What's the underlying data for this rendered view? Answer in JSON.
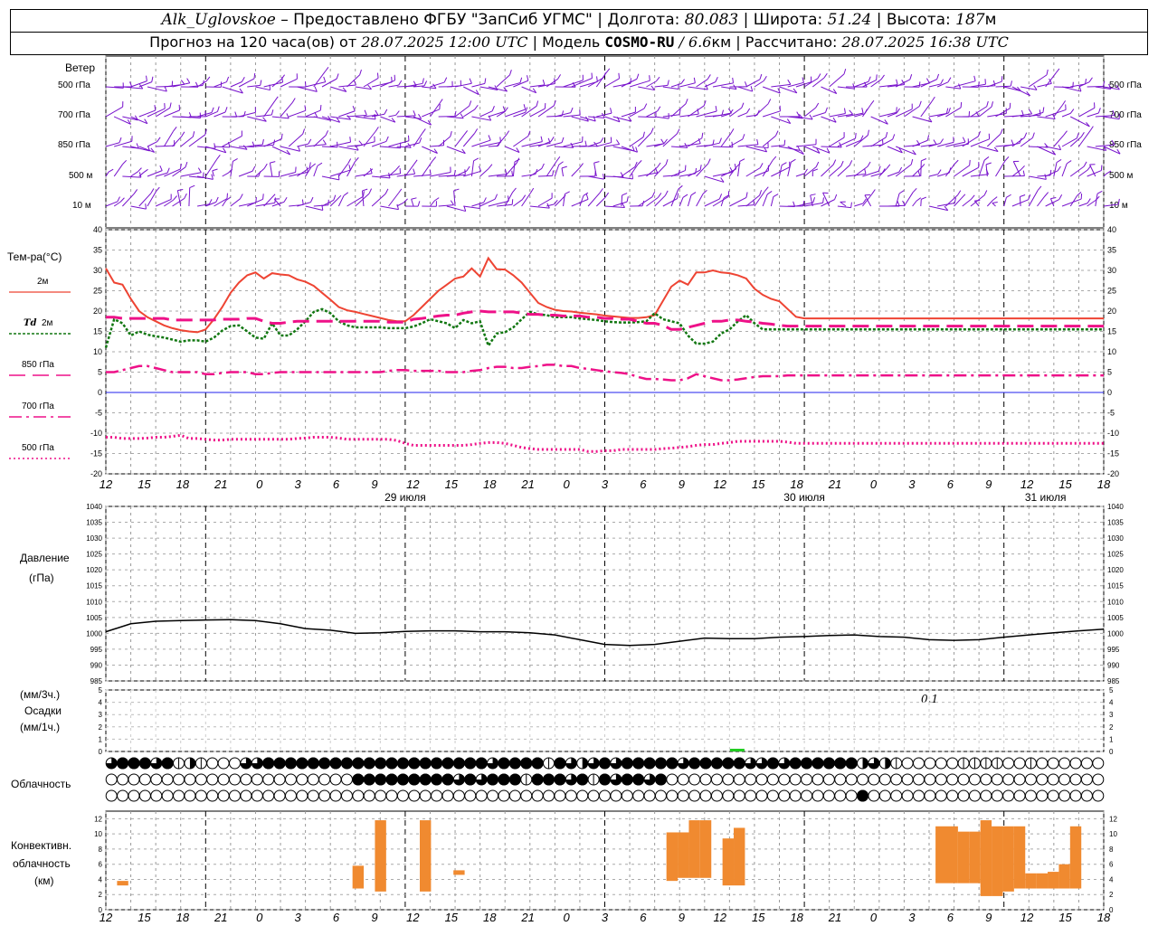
{
  "header": {
    "station": "Alk_Uglovskoe",
    "provider": "– Предоставлено ФГБУ \"ЗапСиб УГМС\"",
    "lon_label": "Долгота:",
    "lon": "80.083",
    "lat_label": "Широта:",
    "lat": "51.24",
    "alt_label": "Высота:",
    "alt": "187",
    "alt_unit": "м",
    "forecast_prefix": "Прогноз на 120 часа(ов) от",
    "forecast_time": "28.07.2025 12:00 UTC",
    "model_label": "| Модель",
    "model": "COSMO-RU",
    "resolution": "/ 6.6",
    "res_unit": "км |",
    "computed_label": "Рассчитано:",
    "computed_time": "28.07.2025 16:38 UTC"
  },
  "labels": {
    "wind": "Ветер",
    "wind_levels": [
      "500 гПа",
      "700 гПа",
      "850 гПа",
      "500 м",
      "10 м"
    ],
    "temp_title": "Тем-ра(°C)",
    "legend_2m": "2м",
    "legend_td": "Td",
    "legend_td_2m": "2м",
    "legend_850": "850 гПа",
    "legend_700": "700 гПа",
    "legend_500": "500 гПа",
    "pressure_title": "Давление",
    "pressure_unit": "(гПа)",
    "precip_unit1": "(мм/3ч.)",
    "precip_title": "Осадки",
    "precip_unit2": "(мм/1ч.)",
    "cloud_title": "Облачность",
    "conv_title1": "Конвективн.",
    "conv_title2": "облачность",
    "conv_unit": "(км)",
    "precip_annotation": "0.1"
  },
  "x_axis": {
    "hour_ticks": [
      "12",
      "15",
      "18",
      "21",
      "0",
      "3",
      "6",
      "9",
      "12",
      "15",
      "18",
      "21",
      "0",
      "3",
      "6",
      "9",
      "12",
      "15",
      "18",
      "21",
      "0",
      "3",
      "6",
      "9",
      "12",
      "15",
      "18"
    ],
    "dates": [
      "29 июля",
      "30 июля",
      "31 июля"
    ]
  },
  "colors": {
    "t2m": "#ee4433",
    "td2m": "#117711",
    "t850": "#ee1188",
    "t700": "#ee1188",
    "t500": "#ee1188",
    "wind": "#7711cc",
    "pressure": "#000000",
    "convective": "#f08a30",
    "precip": "#22cc22",
    "zero_line": "#2222ee"
  },
  "chart_data": [
    {
      "type": "line",
      "name": "temperature",
      "x_hours": [
        0,
        1,
        2,
        3,
        4,
        5,
        6,
        7,
        8,
        9,
        10,
        11,
        12,
        13,
        14,
        15,
        16,
        17,
        18,
        19,
        20,
        21,
        22,
        23,
        24,
        25,
        26,
        27,
        28,
        29,
        30,
        31,
        32,
        33,
        34,
        35,
        36,
        37,
        38,
        39,
        40,
        41,
        42,
        43,
        44,
        45,
        46,
        47,
        48,
        49,
        50,
        51,
        52,
        53,
        54,
        55,
        56,
        57,
        58,
        59,
        60,
        61,
        62,
        63,
        64,
        65,
        66,
        67,
        68,
        69,
        70,
        71,
        72,
        73,
        74,
        75,
        76,
        77,
        78,
        79,
        80,
        81,
        82,
        83,
        84,
        85,
        86,
        87,
        88,
        89,
        90,
        91,
        92,
        93,
        94,
        95,
        96,
        97,
        98,
        99,
        100,
        101,
        102,
        103,
        104,
        105,
        106,
        107,
        108,
        109,
        110,
        111,
        112,
        113,
        114,
        115,
        116,
        117,
        118,
        119,
        120
      ],
      "y_range": [
        -20,
        40
      ],
      "y_ticks": [
        -20,
        -15,
        -10,
        -5,
        0,
        5,
        10,
        15,
        20,
        25,
        30,
        35,
        40
      ],
      "series": [
        {
          "name": "2м",
          "key": "t2m",
          "values": [
            30.5,
            27,
            26.5,
            23,
            20,
            18.5,
            17.5,
            16.5,
            15.8,
            15.3,
            15,
            14.8,
            15.5,
            18,
            21,
            24.5,
            27,
            28.8,
            29.5,
            28,
            29.3,
            29,
            28.8,
            27.8,
            27.2,
            26.2,
            24.5,
            22.8,
            21,
            20.2,
            19.8,
            19.3,
            18.8,
            18.3,
            17.8,
            17.5,
            17.5,
            19,
            21,
            23,
            25,
            26.5,
            28,
            28.5,
            30.5,
            28.5,
            33,
            30.3,
            30.2,
            28.8,
            27,
            24.5,
            22,
            21,
            20.3,
            20,
            19.9,
            19.6,
            19.4,
            19.2,
            18.9,
            18.7,
            18.5,
            18.3,
            18.3,
            18.5,
            19,
            22.5,
            26,
            27.5,
            26.5,
            29.5,
            29.5,
            30,
            29.5,
            29.3,
            28.8,
            28,
            25.5,
            24,
            23,
            22.4,
            20.5,
            18.6,
            18.2,
            18.2,
            18.2,
            18.2,
            18.2,
            18.2,
            18.2,
            18.2,
            18.2,
            18.2,
            18.2,
            18.2,
            18.2,
            18.2,
            18.2,
            18.2,
            18.2,
            18.2,
            18.2,
            18.2,
            18.2,
            18.2,
            18.2,
            18.2,
            18.2,
            18.2,
            18.2,
            18.2,
            18.2,
            18.2,
            18.2,
            18.2,
            18.2,
            18.2,
            18.2,
            18.2,
            18.2
          ]
        },
        {
          "name": "Td 2м",
          "key": "td2m",
          "values": [
            11,
            18,
            17,
            14,
            15,
            14.2,
            13.8,
            13.5,
            13,
            12.5,
            12.8,
            12.8,
            12.5,
            13.5,
            15.2,
            16.3,
            16.5,
            15,
            13.5,
            13.2,
            17,
            14,
            14,
            15.5,
            17.5,
            19.8,
            20.5,
            19.5,
            17.5,
            16.5,
            16,
            16,
            16,
            16,
            15.8,
            15.8,
            15.8,
            16.2,
            17,
            18,
            17.5,
            17,
            15.8,
            17.8,
            17,
            17.5,
            11.5,
            14.5,
            14.8,
            16,
            18,
            19.8,
            19.2,
            19,
            18.5,
            18.5,
            18.5,
            18.2,
            18,
            17.8,
            17.5,
            17.3,
            17.2,
            17.2,
            17.3,
            17.5,
            19.5,
            18,
            17.5,
            17,
            14,
            12,
            12,
            12.5,
            14.5,
            15.5,
            17.5,
            19,
            17,
            15.5,
            15.5,
            15.5,
            15.5,
            15.5,
            15.5,
            15.5,
            15.5,
            15.5,
            15.5,
            15.5,
            15.5,
            15.5,
            15.5,
            15.5,
            15.5,
            15.5,
            15.5,
            15.5,
            15.5,
            15.5,
            15.5,
            15.5,
            15.5,
            15.5,
            15.5,
            15.5,
            15.5,
            15.5,
            15.5,
            15.5,
            15.5,
            15.5,
            15.5,
            15.5,
            15.5,
            15.5,
            15.5,
            15.5,
            15.5,
            15.5,
            15.5
          ]
        },
        {
          "name": "850 гПа",
          "key": "t850",
          "values": [
            18.5,
            18.5,
            18.2,
            18.2,
            18.2,
            18.2,
            18.2,
            18.2,
            17.8,
            17.8,
            17.8,
            17.8,
            17.8,
            17.8,
            18,
            18,
            18,
            18.2,
            18.2,
            17.5,
            17,
            17,
            17.3,
            17.5,
            17.5,
            17.5,
            17.5,
            17.5,
            17.5,
            17.5,
            17.5,
            17.5,
            17.5,
            17.5,
            17.3,
            17.3,
            17.3,
            18,
            18.2,
            18.5,
            18.8,
            19,
            19,
            19.5,
            19.8,
            20,
            19.8,
            19.8,
            19.8,
            19.8,
            19.5,
            19.2,
            19.2,
            19,
            19,
            18.8,
            18.8,
            18.8,
            18.5,
            18.5,
            18.2,
            18.2,
            18,
            18,
            17.5,
            17,
            17,
            16.5,
            15.5,
            15.5,
            16,
            16.5,
            17,
            17.5,
            17.5,
            17.8,
            17.8,
            17.5,
            17.3,
            17,
            16.8,
            16.5,
            16.3,
            16.3,
            16.3,
            16.3,
            16.3,
            16.3,
            16.3,
            16.3,
            16.3,
            16.3,
            16.3,
            16.3,
            16.3,
            16.3,
            16.3,
            16.3,
            16.3,
            16.3,
            16.3,
            16.3,
            16.3,
            16.3,
            16.3,
            16.3,
            16.3,
            16.3,
            16.3,
            16.3,
            16.3,
            16.3,
            16.3,
            16.3,
            16.3,
            16.3,
            16.3,
            16.3,
            16.3,
            16.3,
            16.3
          ]
        },
        {
          "name": "700 гПа",
          "key": "t700",
          "values": [
            5,
            5,
            5.5,
            6,
            6.5,
            6.5,
            6,
            5.5,
            5,
            5,
            5,
            5,
            4.5,
            4.5,
            4.8,
            5,
            5,
            5,
            4.5,
            4.5,
            4.8,
            5,
            5,
            5,
            5,
            5,
            5,
            5,
            5,
            5,
            5,
            5,
            5,
            5,
            5.3,
            5.5,
            5.5,
            5.3,
            5.3,
            5.3,
            5.3,
            5,
            5,
            5,
            5.3,
            5.5,
            6,
            6.3,
            6.3,
            6,
            6,
            6.3,
            6.5,
            6.8,
            6.8,
            6.5,
            6.5,
            6,
            5.8,
            5.5,
            5.2,
            5,
            4.8,
            4.5,
            3.8,
            3.3,
            3.3,
            3.2,
            3,
            3,
            3.5,
            4.5,
            4,
            3.5,
            3,
            3,
            3.2,
            3.5,
            3.8,
            4,
            4,
            4,
            4.2,
            4.2,
            4.2,
            4.2,
            4.2,
            4.2,
            4.2,
            4.2,
            4.2,
            4.2,
            4.2,
            4.2,
            4.2,
            4.2,
            4.2,
            4.2,
            4.2,
            4.2,
            4.2,
            4.2,
            4.2,
            4.2,
            4.2,
            4.2,
            4.2,
            4.2,
            4.2,
            4.2,
            4.2,
            4.2,
            4.2,
            4.2,
            4.2,
            4.2,
            4.2,
            4.2,
            4.2,
            4.2,
            4.2
          ]
        },
        {
          "name": "500 гПа",
          "key": "t500",
          "values": [
            -11,
            -11,
            -11.3,
            -11.3,
            -11.3,
            -11.2,
            -11,
            -11,
            -10.8,
            -10.5,
            -11.3,
            -11.3,
            -11.5,
            -11.7,
            -11.7,
            -11.5,
            -11.5,
            -11.5,
            -11.5,
            -11.5,
            -11.5,
            -11.5,
            -11.5,
            -11.3,
            -11.2,
            -11,
            -11,
            -11,
            -11.2,
            -11.5,
            -11.5,
            -11.5,
            -11.5,
            -11.5,
            -11.5,
            -11.8,
            -12.5,
            -13,
            -13,
            -13,
            -13,
            -13,
            -13,
            -13,
            -12.8,
            -12.5,
            -12.3,
            -12.3,
            -12.5,
            -13,
            -13.5,
            -13.8,
            -14,
            -14,
            -14,
            -14,
            -14,
            -14,
            -14.5,
            -14.5,
            -14.3,
            -14.3,
            -14,
            -14,
            -14,
            -14,
            -14,
            -13.8,
            -13.7,
            -13.5,
            -13.3,
            -13,
            -12.8,
            -12.8,
            -12.5,
            -12.3,
            -12,
            -12,
            -12,
            -12,
            -12,
            -12,
            -12.2,
            -12.5,
            -12.5,
            -12.5,
            -12.5,
            -12.5,
            -12.5,
            -12.5,
            -12.5,
            -12.5,
            -12.5,
            -12.5,
            -12.5,
            -12.5,
            -12.5,
            -12.5,
            -12.5,
            -12.5,
            -12.5,
            -12.5,
            -12.5,
            -12.5,
            -12.5,
            -12.5,
            -12.5,
            -12.5,
            -12.5,
            -12.5,
            -12.5,
            -12.5,
            -12.5,
            -12.5,
            -12.5,
            -12.5,
            -12.5,
            -12.5,
            -12.5,
            -12.5,
            -12.5
          ]
        }
      ]
    },
    {
      "type": "line",
      "name": "pressure",
      "x_hours": [
        0,
        3,
        6,
        9,
        12,
        15,
        18,
        21,
        24,
        27,
        30,
        33,
        36,
        39,
        42,
        45,
        48,
        51,
        54,
        57,
        60,
        63,
        66,
        69,
        72,
        75,
        78,
        81,
        84,
        87,
        90,
        93,
        96,
        99,
        102,
        105,
        108,
        111,
        114,
        117,
        120
      ],
      "y_range": [
        985,
        1040
      ],
      "y_ticks": [
        985,
        990,
        995,
        1000,
        1005,
        1010,
        1015,
        1020,
        1025,
        1030,
        1035,
        1040
      ],
      "series": [
        {
          "name": "Давление",
          "values": [
            1000.5,
            1003,
            1003.8,
            1004,
            1004.2,
            1004.3,
            1004,
            1003,
            1001.5,
            1001,
            1000,
            1000.2,
            1000.6,
            1000.8,
            1000.8,
            1000.5,
            1000.5,
            1000.2,
            999.5,
            998,
            996.5,
            996.2,
            996.5,
            997.5,
            998.5,
            998.3,
            998.3,
            998.8,
            999,
            999.3,
            999.5,
            999,
            998.8,
            998,
            997.8,
            998,
            998.8,
            999.5,
            1000.2,
            1000.8,
            1001.3
          ]
        }
      ]
    },
    {
      "type": "bar",
      "name": "convective_cloud",
      "y_range": [
        0,
        13
      ],
      "y_ticks": [
        0,
        2,
        4,
        6,
        8,
        10,
        12
      ],
      "bars": [
        {
          "x": 1,
          "bottom": 3.2,
          "top": 3.8
        },
        {
          "x": 22,
          "bottom": 2.8,
          "top": 5.8
        },
        {
          "x": 24,
          "bottom": 2.4,
          "top": 11.8
        },
        {
          "x": 28,
          "bottom": 2.4,
          "top": 11.8
        },
        {
          "x": 31,
          "bottom": 4.6,
          "top": 5.2
        },
        {
          "x": 50,
          "bottom": 3.8,
          "top": 10.2
        },
        {
          "x": 51,
          "bottom": 4.2,
          "top": 10.2
        },
        {
          "x": 52,
          "bottom": 4.2,
          "top": 11.8
        },
        {
          "x": 53,
          "bottom": 4.2,
          "top": 11.8
        },
        {
          "x": 55,
          "bottom": 3.2,
          "top": 9.4
        },
        {
          "x": 56,
          "bottom": 3.2,
          "top": 10.8
        },
        {
          "x": 74,
          "bottom": 3.5,
          "top": 11
        },
        {
          "x": 75,
          "bottom": 3.5,
          "top": 11
        },
        {
          "x": 76,
          "bottom": 3.5,
          "top": 10.3
        },
        {
          "x": 77,
          "bottom": 3.5,
          "top": 10.3
        },
        {
          "x": 78,
          "bottom": 1.8,
          "top": 11.8
        },
        {
          "x": 79,
          "bottom": 1.8,
          "top": 11
        },
        {
          "x": 80,
          "bottom": 2.4,
          "top": 11
        },
        {
          "x": 81,
          "bottom": 2.8,
          "top": 11
        },
        {
          "x": 82,
          "bottom": 2.8,
          "top": 4.8
        },
        {
          "x": 83,
          "bottom": 2.8,
          "top": 4.8
        },
        {
          "x": 84,
          "bottom": 2.8,
          "top": 5
        },
        {
          "x": 85,
          "bottom": 2.8,
          "top": 6
        },
        {
          "x": 86,
          "bottom": 2.8,
          "top": 11
        }
      ]
    },
    {
      "type": "bar",
      "name": "precipitation",
      "y_range": [
        0,
        5
      ],
      "y_ticks": [
        0,
        1,
        2,
        3,
        4,
        5
      ],
      "bars": [
        {
          "x": 75.6,
          "value": 0.1
        }
      ]
    },
    {
      "type": "table",
      "name": "cloudiness",
      "rows": [
        "34443412100033444444444444444444443444414323434444434444433434444442321000001111001000000",
        "00000000000000000000004444444443434441444341434434000000000000000000000000000000000000000",
        "00000000000000000000000000000000000000000000000000000000000000000004000000000000000000000"
      ]
    }
  ]
}
